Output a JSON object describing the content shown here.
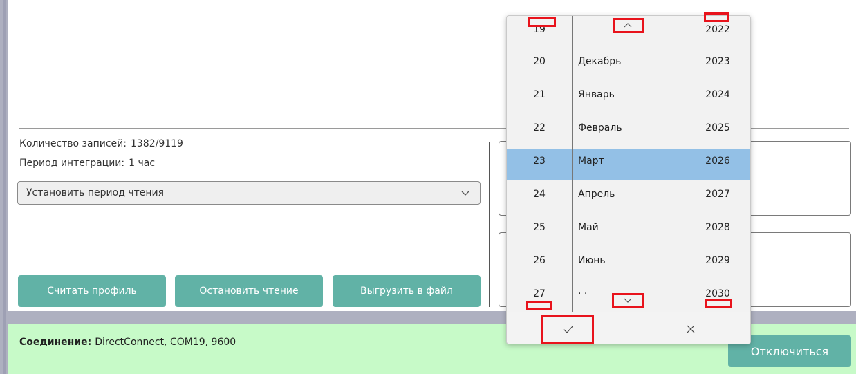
{
  "records": {
    "label": "Количество записей:",
    "value": "1382/9119"
  },
  "integration": {
    "label": "Период интеграции:",
    "value": "1 час"
  },
  "period_select": {
    "value": "Установить период чтения"
  },
  "buttons": {
    "read_profile": "Считать профиль",
    "stop_reading": "Остановить чтение",
    "export_file": "Выгрузить в файл"
  },
  "status": {
    "label": "Соединение:",
    "value": "DirectConnect, COM19, 9600",
    "disconnect": "Отключиться"
  },
  "picker": {
    "rows": [
      {
        "day": "19",
        "month": "",
        "year": "2022"
      },
      {
        "day": "20",
        "month": "Декабрь",
        "year": "2023"
      },
      {
        "day": "21",
        "month": "Январь",
        "year": "2024"
      },
      {
        "day": "22",
        "month": "Февраль",
        "year": "2025"
      },
      {
        "day": "23",
        "month": "Март",
        "year": "2026"
      },
      {
        "day": "24",
        "month": "Апрель",
        "year": "2027"
      },
      {
        "day": "25",
        "month": "Май",
        "year": "2028"
      },
      {
        "day": "26",
        "month": "Июнь",
        "year": "2029"
      },
      {
        "day": "27",
        "month": "· ·",
        "year": "2030"
      }
    ],
    "selected_index": 4,
    "icons": {
      "scroll_up": "chevron-up-icon",
      "scroll_down": "chevron-down-icon",
      "confirm": "checkmark-icon",
      "cancel": "close-icon"
    }
  },
  "colors": {
    "accent": "#61b2a6",
    "status_bg": "#c7fac8",
    "selection": "#93c0e6",
    "highlight": "#e8131c"
  }
}
